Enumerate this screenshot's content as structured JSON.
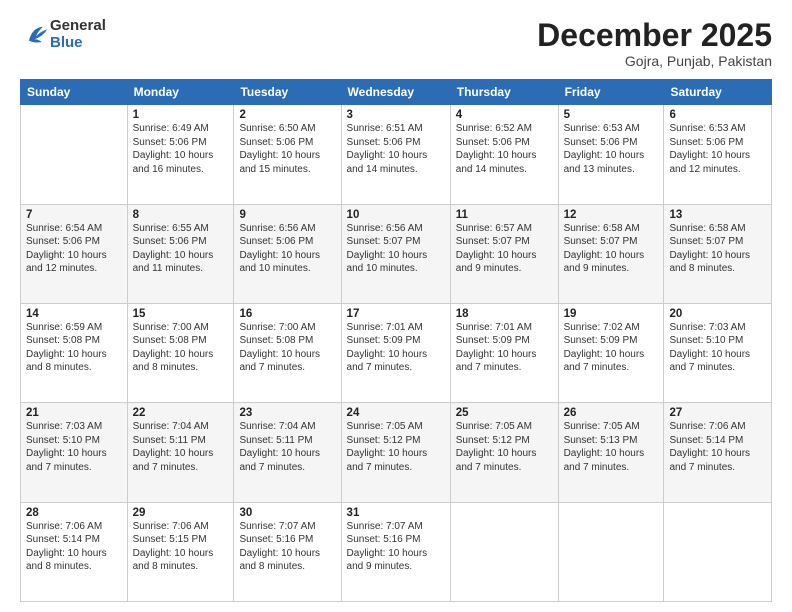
{
  "header": {
    "logo": {
      "general": "General",
      "blue": "Blue"
    },
    "title": "December 2025",
    "location": "Gojra, Punjab, Pakistan"
  },
  "calendar": {
    "days_of_week": [
      "Sunday",
      "Monday",
      "Tuesday",
      "Wednesday",
      "Thursday",
      "Friday",
      "Saturday"
    ],
    "weeks": [
      [
        {
          "day": "",
          "sunrise": "",
          "sunset": "",
          "daylight": ""
        },
        {
          "day": "1",
          "sunrise": "Sunrise: 6:49 AM",
          "sunset": "Sunset: 5:06 PM",
          "daylight": "Daylight: 10 hours and 16 minutes."
        },
        {
          "day": "2",
          "sunrise": "Sunrise: 6:50 AM",
          "sunset": "Sunset: 5:06 PM",
          "daylight": "Daylight: 10 hours and 15 minutes."
        },
        {
          "day": "3",
          "sunrise": "Sunrise: 6:51 AM",
          "sunset": "Sunset: 5:06 PM",
          "daylight": "Daylight: 10 hours and 14 minutes."
        },
        {
          "day": "4",
          "sunrise": "Sunrise: 6:52 AM",
          "sunset": "Sunset: 5:06 PM",
          "daylight": "Daylight: 10 hours and 14 minutes."
        },
        {
          "day": "5",
          "sunrise": "Sunrise: 6:53 AM",
          "sunset": "Sunset: 5:06 PM",
          "daylight": "Daylight: 10 hours and 13 minutes."
        },
        {
          "day": "6",
          "sunrise": "Sunrise: 6:53 AM",
          "sunset": "Sunset: 5:06 PM",
          "daylight": "Daylight: 10 hours and 12 minutes."
        }
      ],
      [
        {
          "day": "7",
          "sunrise": "Sunrise: 6:54 AM",
          "sunset": "Sunset: 5:06 PM",
          "daylight": "Daylight: 10 hours and 12 minutes."
        },
        {
          "day": "8",
          "sunrise": "Sunrise: 6:55 AM",
          "sunset": "Sunset: 5:06 PM",
          "daylight": "Daylight: 10 hours and 11 minutes."
        },
        {
          "day": "9",
          "sunrise": "Sunrise: 6:56 AM",
          "sunset": "Sunset: 5:06 PM",
          "daylight": "Daylight: 10 hours and 10 minutes."
        },
        {
          "day": "10",
          "sunrise": "Sunrise: 6:56 AM",
          "sunset": "Sunset: 5:07 PM",
          "daylight": "Daylight: 10 hours and 10 minutes."
        },
        {
          "day": "11",
          "sunrise": "Sunrise: 6:57 AM",
          "sunset": "Sunset: 5:07 PM",
          "daylight": "Daylight: 10 hours and 9 minutes."
        },
        {
          "day": "12",
          "sunrise": "Sunrise: 6:58 AM",
          "sunset": "Sunset: 5:07 PM",
          "daylight": "Daylight: 10 hours and 9 minutes."
        },
        {
          "day": "13",
          "sunrise": "Sunrise: 6:58 AM",
          "sunset": "Sunset: 5:07 PM",
          "daylight": "Daylight: 10 hours and 8 minutes."
        }
      ],
      [
        {
          "day": "14",
          "sunrise": "Sunrise: 6:59 AM",
          "sunset": "Sunset: 5:08 PM",
          "daylight": "Daylight: 10 hours and 8 minutes."
        },
        {
          "day": "15",
          "sunrise": "Sunrise: 7:00 AM",
          "sunset": "Sunset: 5:08 PM",
          "daylight": "Daylight: 10 hours and 8 minutes."
        },
        {
          "day": "16",
          "sunrise": "Sunrise: 7:00 AM",
          "sunset": "Sunset: 5:08 PM",
          "daylight": "Daylight: 10 hours and 7 minutes."
        },
        {
          "day": "17",
          "sunrise": "Sunrise: 7:01 AM",
          "sunset": "Sunset: 5:09 PM",
          "daylight": "Daylight: 10 hours and 7 minutes."
        },
        {
          "day": "18",
          "sunrise": "Sunrise: 7:01 AM",
          "sunset": "Sunset: 5:09 PM",
          "daylight": "Daylight: 10 hours and 7 minutes."
        },
        {
          "day": "19",
          "sunrise": "Sunrise: 7:02 AM",
          "sunset": "Sunset: 5:09 PM",
          "daylight": "Daylight: 10 hours and 7 minutes."
        },
        {
          "day": "20",
          "sunrise": "Sunrise: 7:03 AM",
          "sunset": "Sunset: 5:10 PM",
          "daylight": "Daylight: 10 hours and 7 minutes."
        }
      ],
      [
        {
          "day": "21",
          "sunrise": "Sunrise: 7:03 AM",
          "sunset": "Sunset: 5:10 PM",
          "daylight": "Daylight: 10 hours and 7 minutes."
        },
        {
          "day": "22",
          "sunrise": "Sunrise: 7:04 AM",
          "sunset": "Sunset: 5:11 PM",
          "daylight": "Daylight: 10 hours and 7 minutes."
        },
        {
          "day": "23",
          "sunrise": "Sunrise: 7:04 AM",
          "sunset": "Sunset: 5:11 PM",
          "daylight": "Daylight: 10 hours and 7 minutes."
        },
        {
          "day": "24",
          "sunrise": "Sunrise: 7:05 AM",
          "sunset": "Sunset: 5:12 PM",
          "daylight": "Daylight: 10 hours and 7 minutes."
        },
        {
          "day": "25",
          "sunrise": "Sunrise: 7:05 AM",
          "sunset": "Sunset: 5:12 PM",
          "daylight": "Daylight: 10 hours and 7 minutes."
        },
        {
          "day": "26",
          "sunrise": "Sunrise: 7:05 AM",
          "sunset": "Sunset: 5:13 PM",
          "daylight": "Daylight: 10 hours and 7 minutes."
        },
        {
          "day": "27",
          "sunrise": "Sunrise: 7:06 AM",
          "sunset": "Sunset: 5:14 PM",
          "daylight": "Daylight: 10 hours and 7 minutes."
        }
      ],
      [
        {
          "day": "28",
          "sunrise": "Sunrise: 7:06 AM",
          "sunset": "Sunset: 5:14 PM",
          "daylight": "Daylight: 10 hours and 8 minutes."
        },
        {
          "day": "29",
          "sunrise": "Sunrise: 7:06 AM",
          "sunset": "Sunset: 5:15 PM",
          "daylight": "Daylight: 10 hours and 8 minutes."
        },
        {
          "day": "30",
          "sunrise": "Sunrise: 7:07 AM",
          "sunset": "Sunset: 5:16 PM",
          "daylight": "Daylight: 10 hours and 8 minutes."
        },
        {
          "day": "31",
          "sunrise": "Sunrise: 7:07 AM",
          "sunset": "Sunset: 5:16 PM",
          "daylight": "Daylight: 10 hours and 9 minutes."
        },
        {
          "day": "",
          "sunrise": "",
          "sunset": "",
          "daylight": ""
        },
        {
          "day": "",
          "sunrise": "",
          "sunset": "",
          "daylight": ""
        },
        {
          "day": "",
          "sunrise": "",
          "sunset": "",
          "daylight": ""
        }
      ]
    ]
  }
}
